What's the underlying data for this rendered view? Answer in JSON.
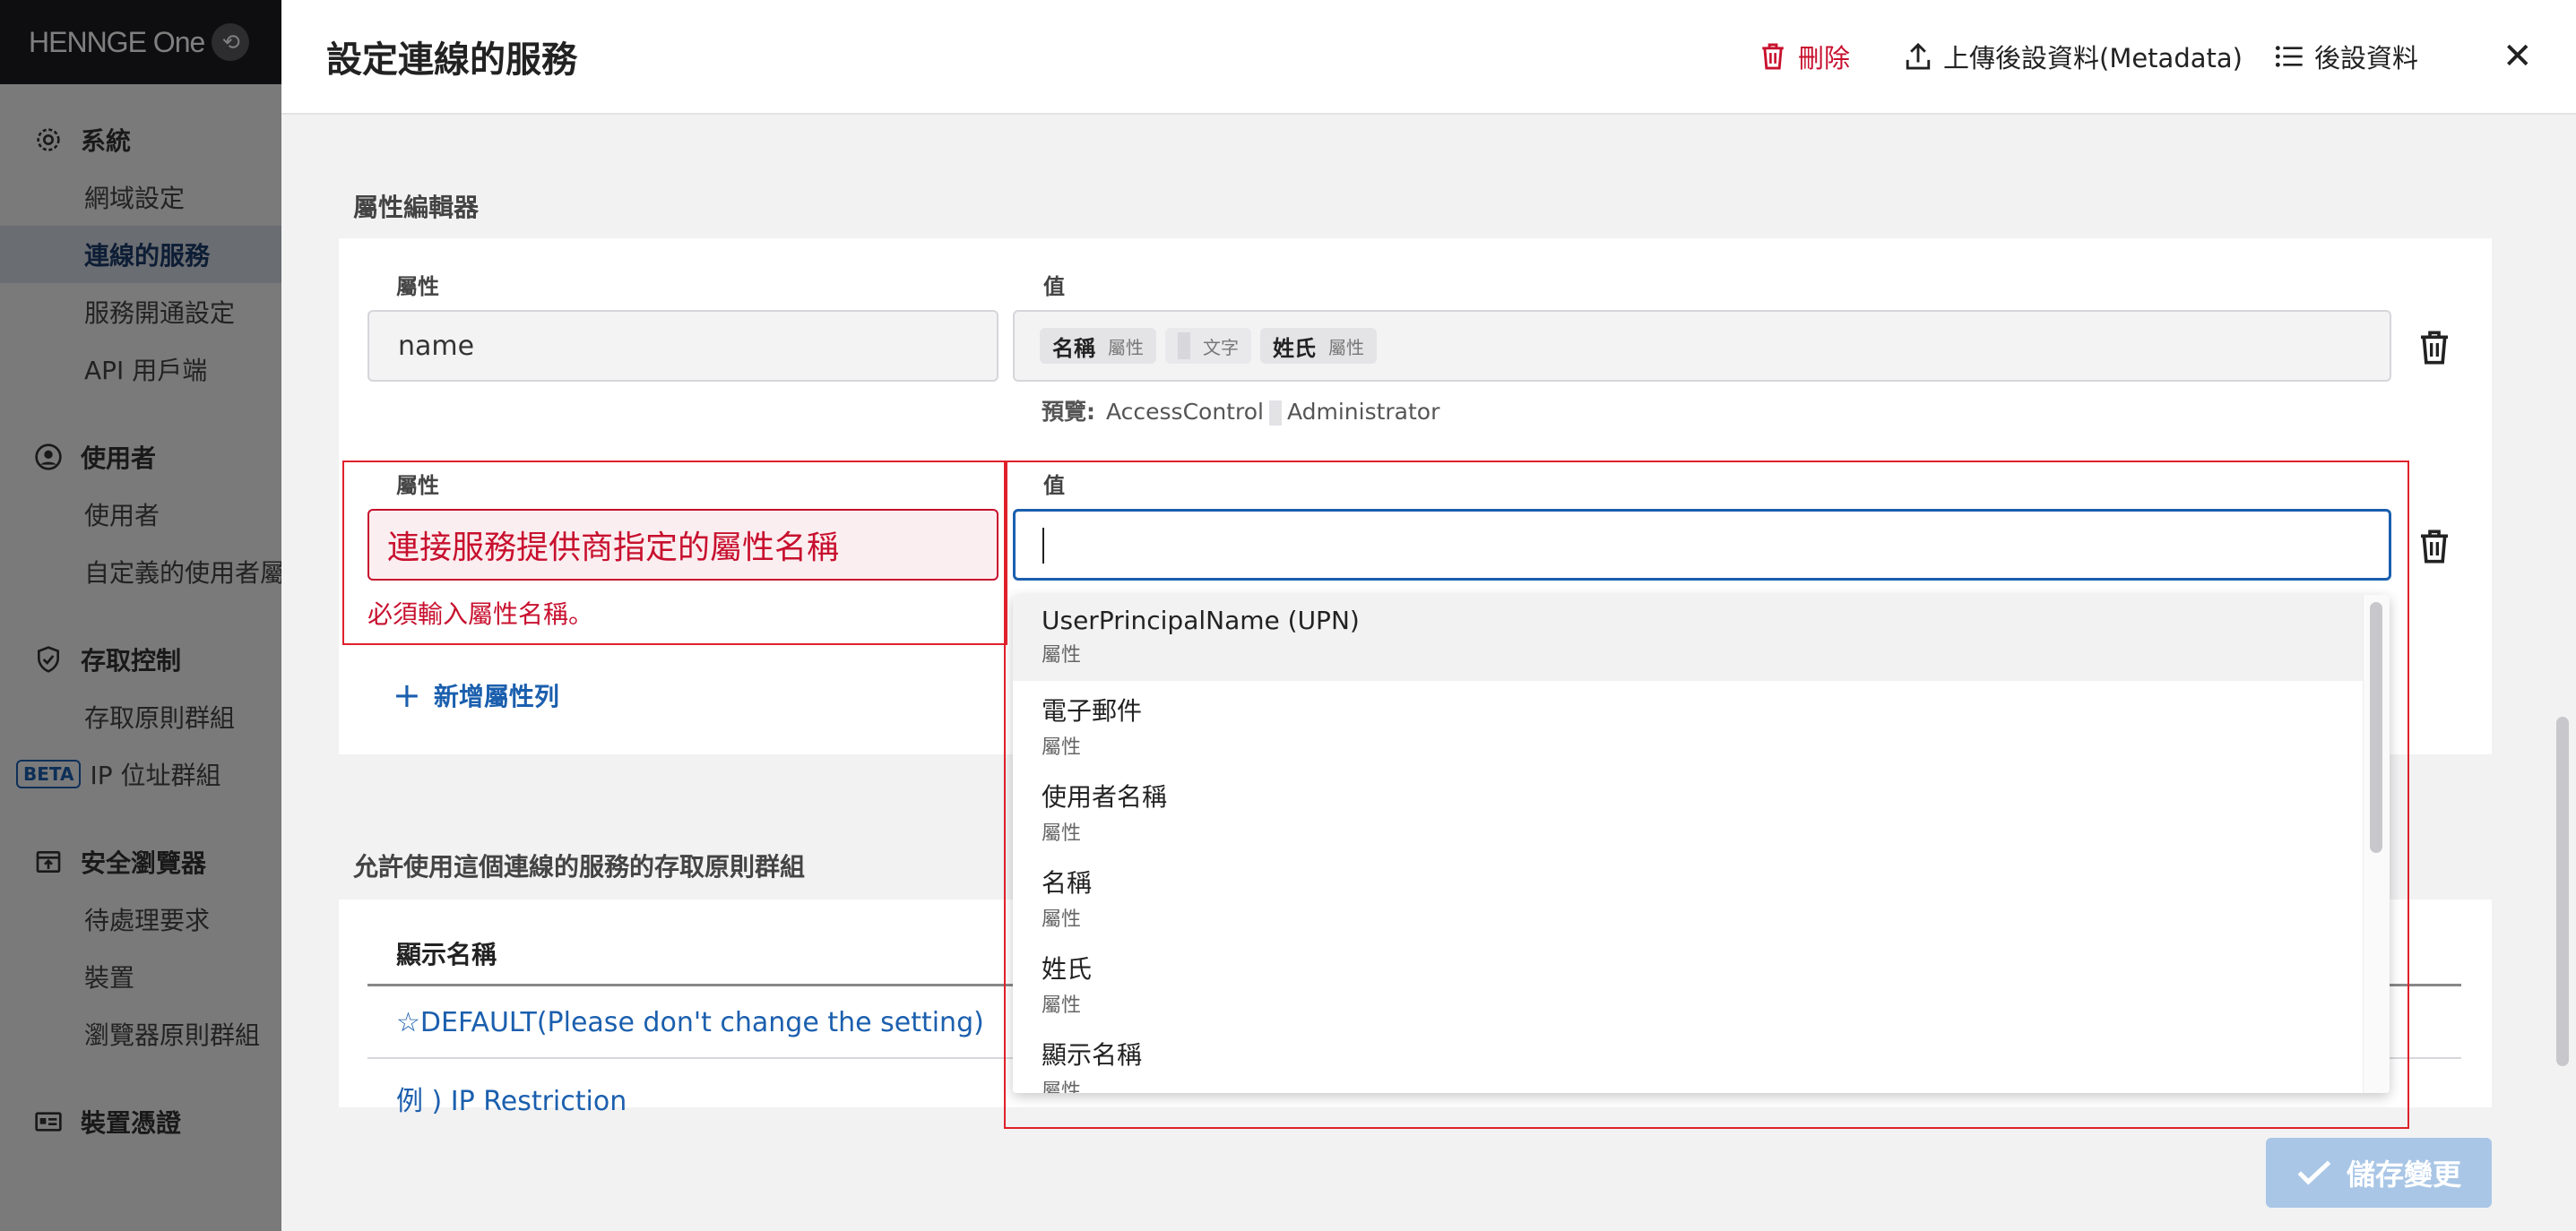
{
  "app": {
    "logo_text": "HENNGE One"
  },
  "sidebar": {
    "sections": [
      {
        "title": "系統",
        "icon": "gear-icon",
        "items": [
          "網域設定",
          "連線的服務",
          "服務開通設定",
          "API 用戶端"
        ]
      },
      {
        "title": "使用者",
        "icon": "user-circle-icon",
        "items": [
          "使用者",
          "自定義的使用者屬性"
        ]
      },
      {
        "title": "存取控制",
        "icon": "shield-icon",
        "items": [
          "存取原則群組",
          "IP 位址群組"
        ]
      },
      {
        "title": "安全瀏覽器",
        "icon": "browser-icon",
        "items": [
          "待處理要求",
          "裝置",
          "瀏覽器原則群組"
        ]
      },
      {
        "title": "裝置憑證",
        "icon": "id-card-icon",
        "items": []
      }
    ],
    "active_item": "連線的服務",
    "beta_label": "BETA"
  },
  "drawer": {
    "title": "設定連線的服務",
    "delete_label": "刪除",
    "upload_label": "上傳後設資料(Metadata)",
    "metadata_label": "後設資料",
    "close_label": "✕"
  },
  "attribute_editor": {
    "section_title": "屬性編輯器",
    "attribute_label": "屬性",
    "value_label": "值",
    "row1": {
      "attribute": "name",
      "tags": [
        {
          "text": "名稱",
          "kind": "屬性"
        },
        {
          "text": "",
          "kind": "文字"
        },
        {
          "text": "姓氏",
          "kind": "屬性"
        }
      ],
      "preview_label": "預覽:",
      "preview_first": "AccessControl",
      "preview_second": "Administrator"
    },
    "row2": {
      "attribute_placeholder": "連接服務提供商指定的屬性名稱",
      "error_message": "必須輸入屬性名稱。",
      "value": ""
    },
    "add_row_label": "新增屬性列"
  },
  "dropdown": {
    "options": [
      {
        "name": "UserPrincipalName (UPN)",
        "kind": "屬性"
      },
      {
        "name": "電子郵件",
        "kind": "屬性"
      },
      {
        "name": "使用者名稱",
        "kind": "屬性"
      },
      {
        "name": "名稱",
        "kind": "屬性"
      },
      {
        "name": "姓氏",
        "kind": "屬性"
      },
      {
        "name": "顯示名稱",
        "kind": "屬性"
      }
    ]
  },
  "access_policy": {
    "section_title": "允許使用這個連線的服務的存取原則群組",
    "column_display_name": "顯示名稱",
    "rows": [
      "☆DEFAULT(Please don't change the setting)",
      "例 ) IP Restriction"
    ]
  },
  "save_label": "儲存變更"
}
